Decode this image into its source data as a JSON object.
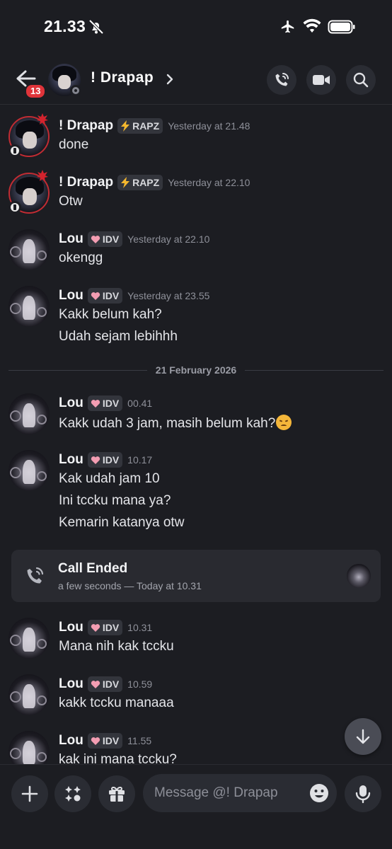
{
  "status_bar": {
    "time": "21.33"
  },
  "header": {
    "title": "! Drapap",
    "unread_count": "13"
  },
  "messages": [
    {
      "author": "! Drapap",
      "tag": "RAPZ",
      "tag_icon": "lightning-icon",
      "time": "Yesterday at 21.48",
      "lines": [
        "done"
      ]
    },
    {
      "author": "! Drapap",
      "tag": "RAPZ",
      "tag_icon": "lightning-icon",
      "time": "Yesterday at 22.10",
      "lines": [
        "Otw"
      ]
    },
    {
      "author": "Lou",
      "tag": "IDV",
      "tag_icon": "heart-icon",
      "time": "Yesterday at 22.10",
      "lines": [
        "okengg"
      ]
    },
    {
      "author": "Lou",
      "tag": "IDV",
      "tag_icon": "heart-icon",
      "time": "Yesterday at 23.55",
      "lines": [
        "Kakk belum kah?",
        "Udah sejam lebihhh"
      ]
    },
    {
      "author": "Lou",
      "tag": "IDV",
      "tag_icon": "heart-icon",
      "time": "00.41",
      "lines": [
        "Kakk udah 3 jam, masih belum kah?"
      ]
    },
    {
      "author": "Lou",
      "tag": "IDV",
      "tag_icon": "heart-icon",
      "time": "10.17",
      "lines": [
        "Kak udah jam 10",
        "Ini tccku mana ya?",
        "Kemarin katanya otw"
      ]
    },
    {
      "author": "Lou",
      "tag": "IDV",
      "tag_icon": "heart-icon",
      "time": "10.31",
      "lines": [
        "Mana nih kak tccku"
      ]
    },
    {
      "author": "Lou",
      "tag": "IDV",
      "tag_icon": "heart-icon",
      "time": "10.59",
      "lines": [
        "kakk tccku manaaa"
      ]
    },
    {
      "author": "Lou",
      "tag": "IDV",
      "tag_icon": "heart-icon",
      "time": "11.55",
      "lines": [
        "kak ini mana tccku?"
      ]
    }
  ],
  "date_divider": "21 February 2026",
  "call": {
    "title": "Call Ended",
    "subtitle": "a few seconds — Today at 10.31"
  },
  "composer": {
    "placeholder": "Message @! Drapap"
  },
  "colors": {
    "background": "#1c1d22",
    "badge": "#e0343a",
    "card": "#292a30",
    "tag_bg": "#33353c"
  }
}
